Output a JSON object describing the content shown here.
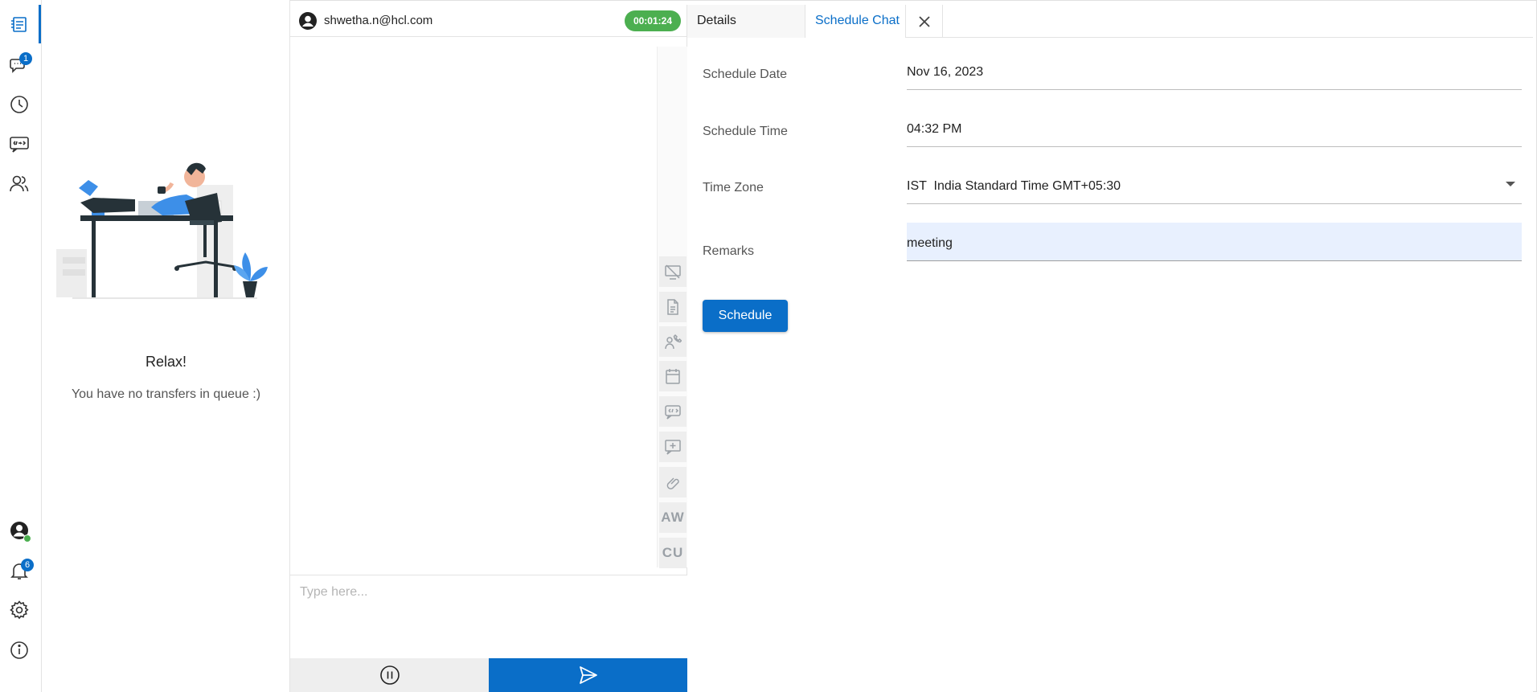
{
  "rail": {
    "items": [
      {
        "name": "queue-list-icon"
      },
      {
        "name": "chat-icon",
        "badge": "1"
      },
      {
        "name": "history-clock-icon"
      },
      {
        "name": "canned-message-icon"
      },
      {
        "name": "contacts-icon"
      }
    ],
    "bottom": [
      {
        "name": "agent-status-icon"
      },
      {
        "name": "notification-bell-icon",
        "badge": "6"
      },
      {
        "name": "settings-gear-icon"
      },
      {
        "name": "info-icon"
      }
    ]
  },
  "queue": {
    "title": "Relax!",
    "subtitle": "You have no transfers in queue :)"
  },
  "chat": {
    "email": "shwetha.n@hcl.com",
    "timer": "00:01:24",
    "composer_placeholder": "Type here...",
    "tools": [
      {
        "name": "hide-screen-icon"
      },
      {
        "name": "transcript-icon"
      },
      {
        "name": "call-icon"
      },
      {
        "name": "calendar-icon"
      },
      {
        "name": "quick-reply-icon"
      },
      {
        "name": "add-comment-icon"
      },
      {
        "name": "attachment-icon"
      },
      {
        "name": "aw-button",
        "label": "AW"
      },
      {
        "name": "cu-button",
        "label": "CU"
      }
    ]
  },
  "details": {
    "tabs": {
      "details": "Details",
      "schedule_chat": "Schedule Chat"
    },
    "form": {
      "date_label": "Schedule Date",
      "date_value": "Nov 16, 2023",
      "time_label": "Schedule Time",
      "time_value": "04:32 PM",
      "timezone_label": "Time Zone",
      "timezone_value": "IST  India Standard Time GMT+05:30",
      "remarks_label": "Remarks",
      "remarks_value": "meeting"
    },
    "schedule_button": "Schedule"
  },
  "colors": {
    "accent": "#0a6ec8",
    "timer_green": "#4caf50",
    "remarks_fill": "#e8f0fe"
  }
}
